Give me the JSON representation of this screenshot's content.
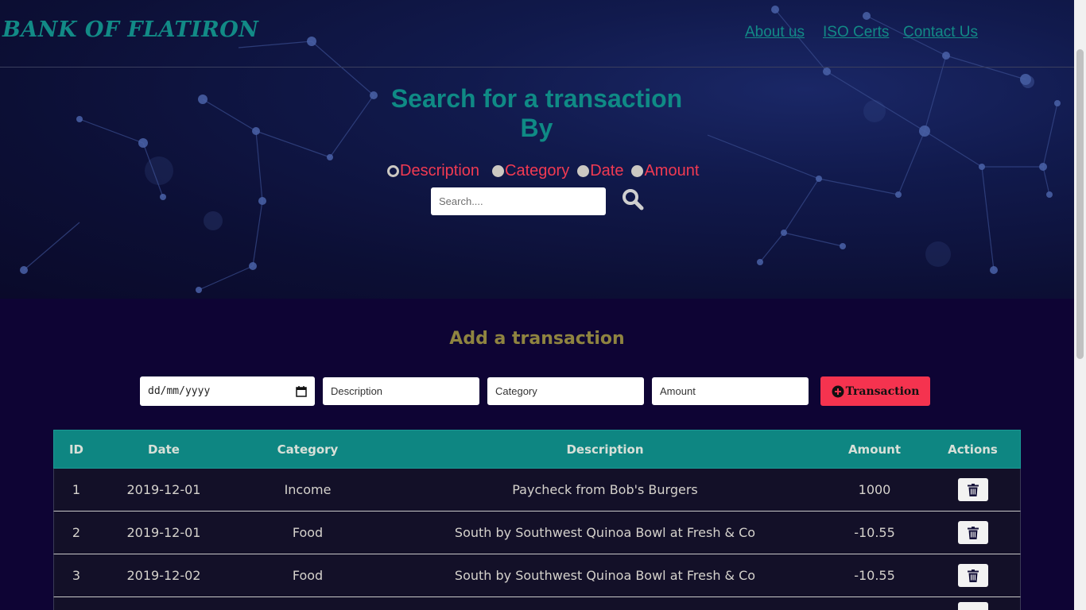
{
  "brand": "BANK OF FLATIRON",
  "nav": {
    "about": "About us",
    "iso": "ISO Certs",
    "contact": "Contact Us"
  },
  "search": {
    "title_line1": "Search for a transaction",
    "title_line2": "By",
    "options": [
      "Description",
      "Category",
      "Date",
      "Amount"
    ],
    "selected": "Description",
    "placeholder": "Search....",
    "icon": "search-icon"
  },
  "add": {
    "title": "Add a transaction",
    "date_placeholder": "dd/mm/yyyy",
    "description_placeholder": "Description",
    "category_placeholder": "Category",
    "amount_placeholder": "Amount",
    "button_label": "Transaction",
    "button_icon": "plus-circle-icon"
  },
  "table": {
    "headers": {
      "id": "ID",
      "date": "Date",
      "category": "Category",
      "description": "Description",
      "amount": "Amount",
      "actions": "Actions"
    },
    "rows": [
      {
        "id": "1",
        "date": "2019-12-01",
        "category": "Income",
        "description": "Paycheck from Bob's Burgers",
        "amount": "1000"
      },
      {
        "id": "2",
        "date": "2019-12-01",
        "category": "Food",
        "description": "South by Southwest Quinoa Bowl at Fresh & Co",
        "amount": "-10.55"
      },
      {
        "id": "3",
        "date": "2019-12-02",
        "category": "Food",
        "description": "South by Southwest Quinoa Bowl at Fresh & Co",
        "amount": "-10.55"
      }
    ]
  },
  "colors": {
    "background": "#0e0434",
    "teal": "#0e8682",
    "accent_red": "#f5334f",
    "olive": "#8f8440"
  }
}
